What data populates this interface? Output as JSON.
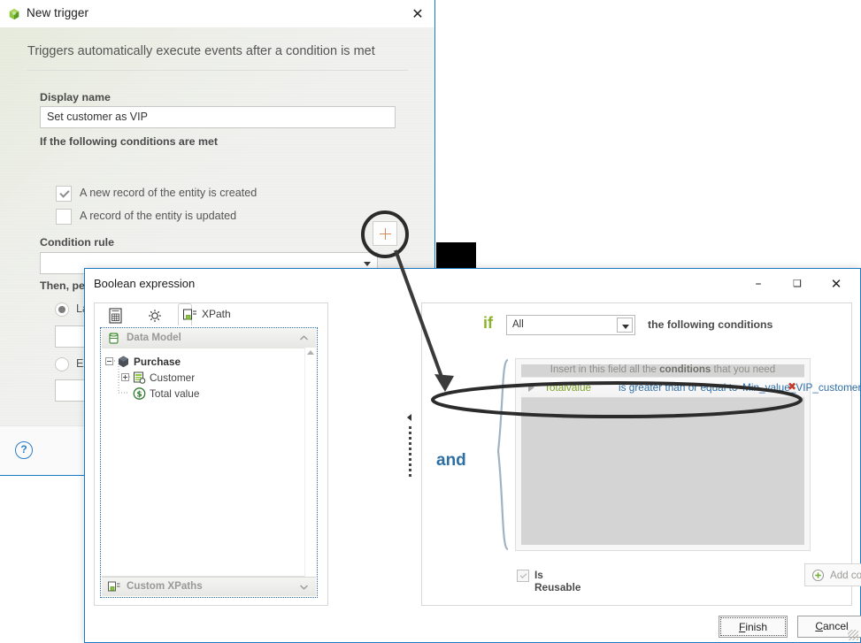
{
  "trigger_dialog": {
    "title": "New trigger",
    "app_icon": "cube-icon",
    "close_icon": "close-icon",
    "subtitle": "Triggers automatically execute events after a condition is met",
    "display_name": {
      "label": "Display name",
      "value": "Set customer as VIP"
    },
    "conditions_met_label": "If the following conditions are met",
    "checkboxes": [
      {
        "label": "A new record of the entity is created",
        "checked": true
      },
      {
        "label": "A record of the entity is updated",
        "checked": false
      }
    ],
    "condition_rule": {
      "label": "Condition rule",
      "value": "",
      "dropdown_icon": "chevron-down-icon",
      "add_icon": "plus-icon"
    },
    "then_perform_label": "Then, perform this event",
    "radios": [
      {
        "label": "La",
        "selected": true
      },
      {
        "label": "Ex",
        "selected": false
      }
    ],
    "help_icon": "help-icon",
    "help_glyph": "?"
  },
  "boolean_dialog": {
    "title": "Boolean expression",
    "window_controls": {
      "minimize": "–",
      "maximize": "❑",
      "close": "✕"
    },
    "xpath_panel": {
      "toolbar": {
        "doc_icon": "document-grid-icon",
        "gear_icon": "gear-icon",
        "tab_label": "XPath",
        "tab_icon": "xpath-icon"
      },
      "data_model": {
        "group_label": "Data Model",
        "group_icon": "database-icon",
        "collapse_icon": "chevron-up-icon",
        "tree": [
          {
            "label": "Purchase",
            "icon": "entity-icon",
            "depth": 0,
            "expander": "minus"
          },
          {
            "label": "Customer",
            "icon": "reference-icon",
            "depth": 1,
            "expander": "plus"
          },
          {
            "label": "Total value",
            "icon": "currency-icon",
            "depth": 1,
            "expander": "none"
          }
        ]
      },
      "custom_xpaths": {
        "group_label": "Custom XPaths",
        "group_icon": "xpath-icon",
        "expand_icon": "chevron-down-icon"
      }
    },
    "expression_panel": {
      "if_label": "if",
      "scope_select": {
        "value": "All",
        "dropdown_icon": "chevron-down-icon"
      },
      "following_conditions_label": "the following conditions",
      "and_label": "and",
      "watermark": {
        "prefix": "Insert in this field all the ",
        "emphasis": "conditions",
        "suffix": " that you need"
      },
      "condition_row": {
        "expander_icon": "triangle-right-icon",
        "field": "Totalvalue",
        "operator": "is greater than or equal to",
        "value": "Min_value_VIP_customer",
        "remove_icon": "remove-x-icon",
        "remove_glyph": "✖"
      },
      "is_reusable": {
        "label": "Is Reusable",
        "checked": true
      },
      "add_condition": {
        "label": "Add condition",
        "icon": "plus-circle-icon"
      }
    },
    "footer": {
      "finish_prefix": "F",
      "finish_rest": "inish",
      "cancel_prefix": "C",
      "cancel_rest": "ancel"
    }
  },
  "annotation": {
    "magnifier": "magnifier-circle",
    "arrow": "pointer-arrow",
    "redaction": "redaction-block"
  },
  "colors": {
    "accent_blue": "#1a7bc4",
    "if_green": "#8ab32b",
    "and_blue": "#2d6fa3",
    "field_green": "#7da324",
    "value_blue": "#2e6ea8",
    "remove_red": "#c0392b"
  }
}
